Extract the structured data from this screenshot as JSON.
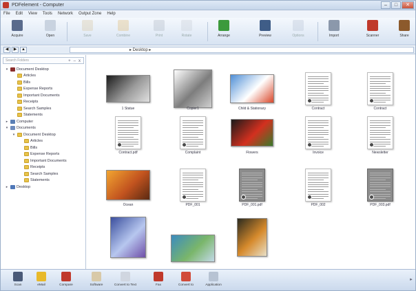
{
  "window": {
    "title": "PDFelement - Computer",
    "controls": {
      "minimize": "–",
      "maximize": "□",
      "close": "✕"
    }
  },
  "menu": [
    "File",
    "Edit",
    "View",
    "Tools",
    "Network",
    "Output Zone",
    "Help"
  ],
  "toolbar": [
    {
      "id": "scan",
      "label": "Acquire",
      "color": "#5a6b8c",
      "enabled": true
    },
    {
      "id": "new",
      "label": "Open",
      "color": "#c9d3e0",
      "enabled": true
    },
    {
      "id": "save",
      "label": "Save",
      "color": "#d6c7a0",
      "enabled": false
    },
    {
      "id": "combine",
      "label": "Combine",
      "color": "#e0b974",
      "enabled": false
    },
    {
      "id": "print",
      "label": "Print",
      "color": "#b0b8c4",
      "enabled": false
    },
    {
      "id": "rotate",
      "label": "Rotate",
      "color": "#c9ced8",
      "enabled": false
    },
    {
      "id": "arrange",
      "label": "Arrange",
      "color": "#3c9a3c",
      "enabled": true
    },
    {
      "id": "preview",
      "label": "Preview",
      "color": "#3f5d87",
      "enabled": true
    },
    {
      "id": "options",
      "label": "Options",
      "color": "#b7c3d3",
      "enabled": false
    },
    {
      "id": "import",
      "label": "Import",
      "color": "#8b98ab",
      "enabled": true
    },
    {
      "id": "scansend",
      "label": "Scanner",
      "color": "#c0392b",
      "enabled": true
    },
    {
      "id": "share",
      "label": "Share",
      "color": "#8c5a2c",
      "enabled": true
    }
  ],
  "address": {
    "back": "◀",
    "forward": "▶",
    "up": "▲",
    "path": "▸ Desktop ▸"
  },
  "sidebar": {
    "search_placeholder": "Search Folders",
    "tools": [
      "+",
      "–",
      "x"
    ],
    "tree": [
      {
        "label": "Document Desktop",
        "level": 0,
        "icon": "root",
        "toggle": "▾"
      },
      {
        "label": "Articles",
        "level": 1,
        "icon": "folder",
        "toggle": ""
      },
      {
        "label": "Bills",
        "level": 1,
        "icon": "folder",
        "toggle": ""
      },
      {
        "label": "Expense Reports",
        "level": 1,
        "icon": "folder",
        "toggle": ""
      },
      {
        "label": "Important Documents",
        "level": 1,
        "icon": "folder",
        "toggle": ""
      },
      {
        "label": "Receipts",
        "level": 1,
        "icon": "folder",
        "toggle": ""
      },
      {
        "label": "Search Samples",
        "level": 1,
        "icon": "folder",
        "toggle": ""
      },
      {
        "label": "Statements",
        "level": 1,
        "icon": "folder",
        "toggle": ""
      },
      {
        "label": "Computer",
        "level": 0,
        "icon": "computer",
        "toggle": "▸"
      },
      {
        "label": "Documents",
        "level": 0,
        "icon": "docs",
        "toggle": "▾"
      },
      {
        "label": "Document Desktop",
        "level": 1,
        "icon": "folder",
        "toggle": "▾"
      },
      {
        "label": "Articles",
        "level": 2,
        "icon": "folder",
        "toggle": ""
      },
      {
        "label": "Bills",
        "level": 2,
        "icon": "folder",
        "toggle": ""
      },
      {
        "label": "Expense Reports",
        "level": 2,
        "icon": "folder",
        "toggle": ""
      },
      {
        "label": "Important Documents",
        "level": 2,
        "icon": "folder",
        "toggle": ""
      },
      {
        "label": "Receipts",
        "level": 2,
        "icon": "folder",
        "toggle": ""
      },
      {
        "label": "Search Samples",
        "level": 2,
        "icon": "folder",
        "toggle": ""
      },
      {
        "label": "Statements",
        "level": 2,
        "icon": "folder",
        "toggle": ""
      },
      {
        "label": "Desktop",
        "level": 0,
        "icon": "desk",
        "toggle": "▸"
      }
    ]
  },
  "files": [
    {
      "caption": "1 Statue",
      "kind": "photo",
      "colors": [
        "#1b1b1b",
        "#9a9a9a",
        "#e0e0e0"
      ]
    },
    {
      "caption": "Copier1",
      "kind": "photo",
      "colors": [
        "#ffffff",
        "#7d7d7d",
        "#cfcfcf"
      ]
    },
    {
      "caption": "Child & Stationary",
      "kind": "photo",
      "colors": [
        "#4f8fd6",
        "#ffffff",
        "#d9482b"
      ]
    },
    {
      "caption": "Contract",
      "kind": "doc",
      "colors": [
        "#ffffff"
      ]
    },
    {
      "caption": "Contract",
      "kind": "doc",
      "colors": [
        "#ffffff"
      ]
    },
    {
      "caption": "Contract.pdf",
      "kind": "doc",
      "colors": [
        "#ffffff"
      ]
    },
    {
      "caption": "Complaint",
      "kind": "doc",
      "colors": [
        "#ffffff"
      ]
    },
    {
      "caption": "Flowers",
      "kind": "photo",
      "colors": [
        "#1a1a1a",
        "#d3301f",
        "#3a7a2a"
      ]
    },
    {
      "caption": "Invoice",
      "kind": "doc",
      "colors": [
        "#ffffff"
      ]
    },
    {
      "caption": "Newsletter",
      "kind": "doc",
      "colors": [
        "#ffffff"
      ]
    },
    {
      "caption": "Ocean",
      "kind": "photo",
      "colors": [
        "#f2a531",
        "#c2531f",
        "#5a2a12"
      ]
    },
    {
      "caption": "PDF_001",
      "kind": "doc",
      "colors": [
        "#ffffff"
      ]
    },
    {
      "caption": "PDF_001.pdf",
      "kind": "graydoc",
      "colors": [
        "#8c8c8c"
      ]
    },
    {
      "caption": "PDF_002",
      "kind": "doc",
      "colors": [
        "#ffffff"
      ]
    },
    {
      "caption": "PDF_003.pdf",
      "kind": "graydoc",
      "colors": [
        "#8c8c8c"
      ]
    },
    {
      "caption": "",
      "kind": "photo",
      "colors": [
        "#3b4f9e",
        "#b7c7ef",
        "#6f4fa8"
      ]
    },
    {
      "caption": "",
      "kind": "photo",
      "colors": [
        "#3b8bbf",
        "#7ab66a",
        "#c2d9e8"
      ]
    },
    {
      "caption": "",
      "kind": "photo",
      "colors": [
        "#2b2b1f",
        "#d68a2c",
        "#e8e0c8"
      ]
    }
  ],
  "taskbar": [
    {
      "label": "Scan",
      "color": "#4a5a78"
    },
    {
      "label": "eMail",
      "color": "#e8b92a"
    },
    {
      "label": "Compare",
      "color": "#c0392b"
    },
    {
      "label": "Software",
      "color": "#d8c9a8"
    },
    {
      "label": "Convert to Text",
      "color": "#d0d6e0"
    },
    {
      "label": "Fax",
      "color": "#c0392b"
    },
    {
      "label": "Convert to",
      "color": "#d14b3a"
    },
    {
      "label": "Application",
      "color": "#b7c3d3"
    }
  ],
  "scroll_arrow": "▸"
}
